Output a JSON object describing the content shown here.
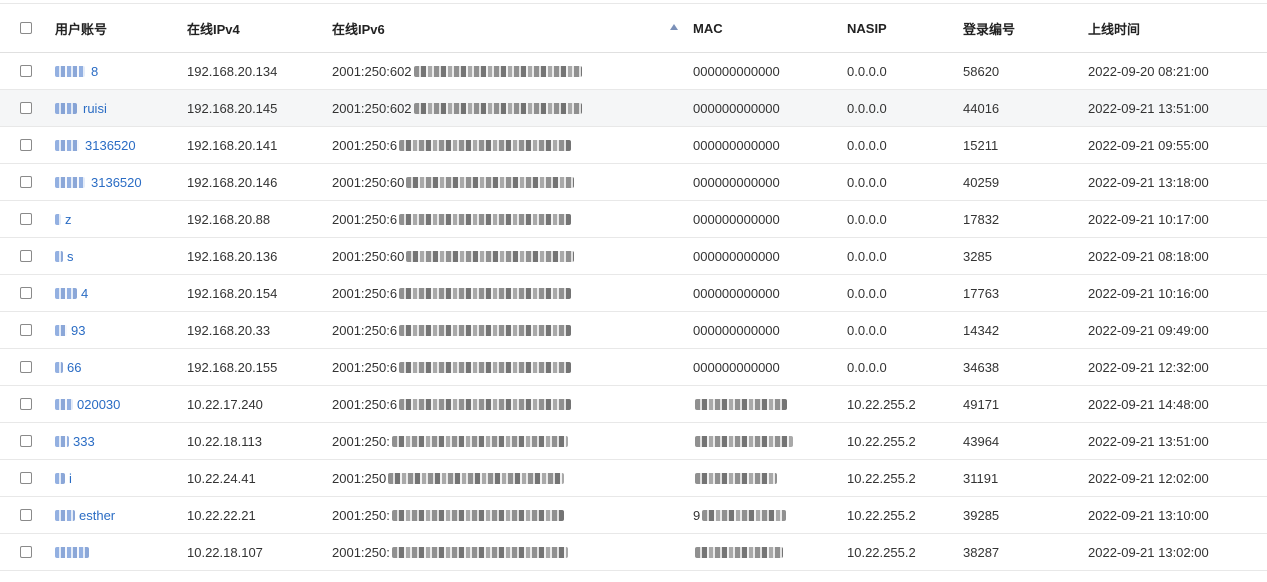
{
  "table": {
    "headers": {
      "user": "用户账号",
      "ipv4": "在线IPv4",
      "ipv6": "在线IPv6",
      "mac": "MAC",
      "nasip": "NASIP",
      "login_no": "登录编号",
      "online_time": "上线时间"
    },
    "sort_icon": "sort-ascending-icon",
    "highlight_row_index": 1,
    "rows": [
      {
        "user": "8",
        "ipv4": "192.168.20.134",
        "ipv6": "2001:250:602",
        "mac": "000000000000",
        "nasip": "0.0.0.0",
        "login_no": "58620",
        "time": "2022-09-20 08:21:00"
      },
      {
        "user": "ruisi",
        "ipv4": "192.168.20.145",
        "ipv6": "2001:250:602",
        "mac": "000000000000",
        "nasip": "0.0.0.0",
        "login_no": "44016",
        "time": "2022-09-21 13:51:00"
      },
      {
        "user": "3136520",
        "ipv4": "192.168.20.141",
        "ipv6": "2001:250:6",
        "mac": "000000000000",
        "nasip": "0.0.0.0",
        "login_no": "15211",
        "time": "2022-09-21 09:55:00"
      },
      {
        "user": "3136520",
        "ipv4": "192.168.20.146",
        "ipv6": "2001:250:60",
        "mac": "000000000000",
        "nasip": "0.0.0.0",
        "login_no": "40259",
        "time": "2022-09-21 13:18:00"
      },
      {
        "user": "z",
        "ipv4": "192.168.20.88",
        "ipv6": "2001:250:6",
        "mac": "000000000000",
        "nasip": "0.0.0.0",
        "login_no": "17832",
        "time": "2022-09-21 10:17:00"
      },
      {
        "user": "s",
        "ipv4": "192.168.20.136",
        "ipv6": "2001:250:60",
        "mac": "000000000000",
        "nasip": "0.0.0.0",
        "login_no": "3285",
        "time": "2022-09-21 08:18:00"
      },
      {
        "user": "4",
        "ipv4": "192.168.20.154",
        "ipv6": "2001:250:6",
        "mac": "000000000000",
        "nasip": "0.0.0.0",
        "login_no": "17763",
        "time": "2022-09-21 10:16:00"
      },
      {
        "user": "93",
        "ipv4": "192.168.20.33",
        "ipv6": "2001:250:6",
        "mac": "000000000000",
        "nasip": "0.0.0.0",
        "login_no": "14342",
        "time": "2022-09-21 09:49:00"
      },
      {
        "user": "66",
        "ipv4": "192.168.20.155",
        "ipv6": "2001:250:6",
        "mac": "000000000000",
        "nasip": "0.0.0.0",
        "login_no": "34638",
        "time": "2022-09-21 12:32:00"
      },
      {
        "user": "020030",
        "ipv4": "10.22.17.240",
        "ipv6": "2001:250:6",
        "mac": "",
        "nasip": "10.22.255.2",
        "login_no": "49171",
        "time": "2022-09-21 14:48:00"
      },
      {
        "user": "333",
        "ipv4": "10.22.18.113",
        "ipv6": "2001:250:",
        "mac": "",
        "nasip": "10.22.255.2",
        "login_no": "43964",
        "time": "2022-09-21 13:51:00"
      },
      {
        "user": "i",
        "ipv4": "10.22.24.41",
        "ipv6": "2001:250",
        "mac": "",
        "nasip": "10.22.255.2",
        "login_no": "31191",
        "time": "2022-09-21 12:02:00"
      },
      {
        "user": "esther",
        "ipv4": "10.22.22.21",
        "ipv6": "2001:250:",
        "mac": "9",
        "nasip": "10.22.255.2",
        "login_no": "39285",
        "time": "2022-09-21 13:10:00"
      },
      {
        "user": "",
        "ipv4": "10.22.18.107",
        "ipv6": "2001:250:",
        "mac": "",
        "nasip": "10.22.255.2",
        "login_no": "38287",
        "time": "2022-09-21 13:02:00"
      }
    ]
  }
}
